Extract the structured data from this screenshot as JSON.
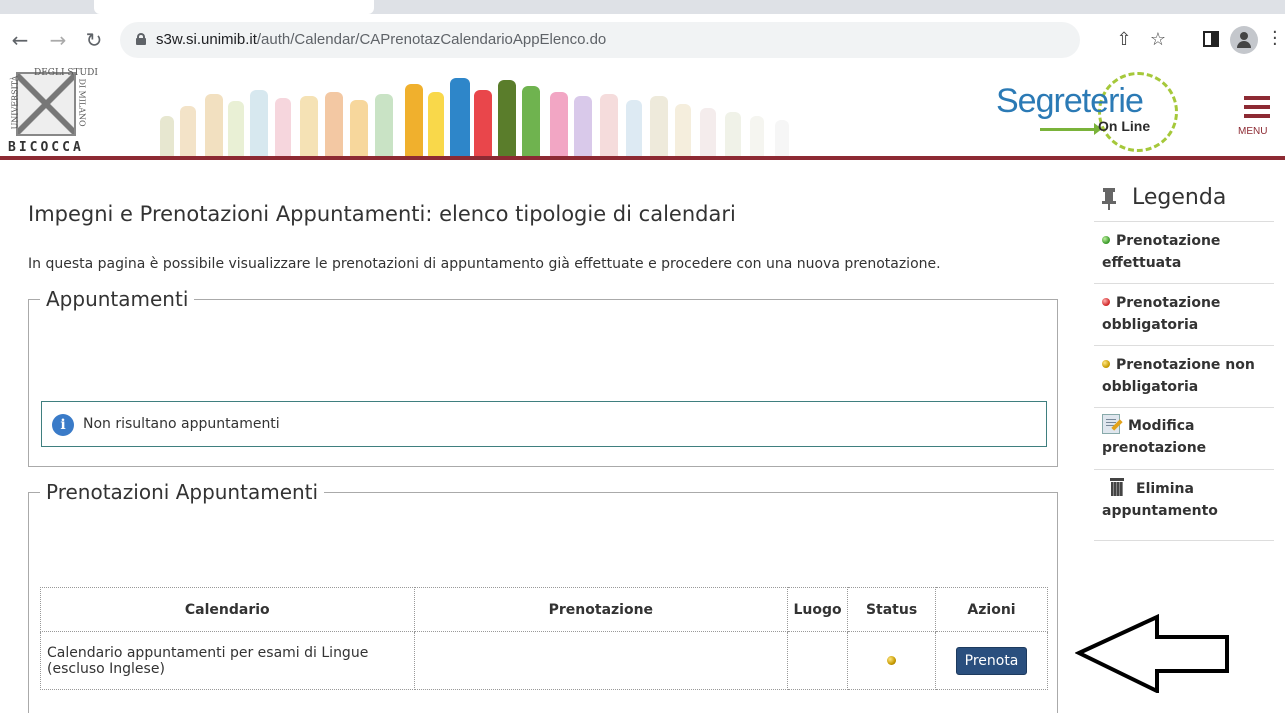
{
  "browser": {
    "url_host": "s3w.si.unimib.it",
    "url_path": "/auth/Calendar/CAPrenotazCalendarioAppElenco.do",
    "back_icon": "arrow-left-icon",
    "forward_icon": "arrow-right-icon",
    "reload_icon": "reload-icon",
    "toolbar_icons": [
      "share-icon",
      "star-icon",
      "side-panel-icon",
      "profile-icon",
      "kebab-menu-icon"
    ]
  },
  "header": {
    "uni_logo_top": "DEGLI STUDI",
    "uni_logo_left": "UNIVERSITÀ",
    "uni_logo_right": "DI MILANO",
    "uni_logo_name": "BICOCCA",
    "portal_logo_main": "Segreterie",
    "portal_logo_sub": "On Line",
    "menu_label": "MENU",
    "accent_color": "#8d2a33"
  },
  "main": {
    "title": "Impegni e Prenotazioni Appuntamenti: elenco tipologie di calendari",
    "description": "In questa pagina è possibile visualizzare le prenotazioni di appuntamento già effettuate e procedere con una nuova prenotazione.",
    "appuntamenti": {
      "legend": "Appuntamenti",
      "empty_message": "Non risultano appuntamenti"
    },
    "prenotazioni": {
      "legend": "Prenotazioni Appuntamenti",
      "columns": [
        "Calendario",
        "Prenotazione",
        "Luogo",
        "Status",
        "Azioni"
      ],
      "rows": [
        {
          "calendario": "Calendario appuntamenti per esami di Lingue (escluso Inglese)",
          "prenotazione": "",
          "luogo": "",
          "status": "prenotazione non obbligatoria",
          "status_color": "#c79a00",
          "azione": "Prenota"
        }
      ]
    }
  },
  "legenda": {
    "title": "Legenda",
    "items": [
      {
        "icon": "green-dot-icon",
        "label": "Prenotazione effettuata"
      },
      {
        "icon": "red-dot-icon",
        "label": "Prenotazione obbligatoria"
      },
      {
        "icon": "yellow-dot-icon",
        "label": "Prenotazione non obbligatoria"
      },
      {
        "icon": "edit-document-icon",
        "label": "Modifica prenotazione"
      },
      {
        "icon": "trash-icon",
        "label": "Elimina appuntamento"
      }
    ]
  }
}
